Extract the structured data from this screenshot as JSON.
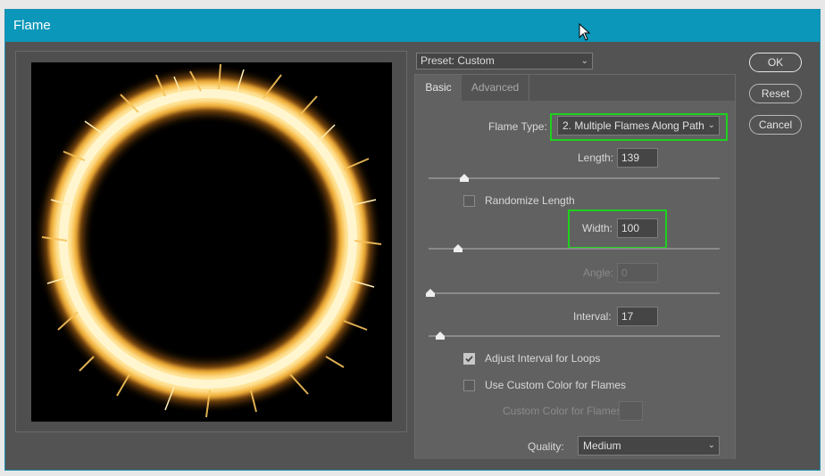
{
  "window": {
    "title": "Flame"
  },
  "preset": {
    "label": "Preset: Custom"
  },
  "tabs": [
    {
      "label": "Basic"
    },
    {
      "label": "Advanced"
    }
  ],
  "basic": {
    "flame_type": {
      "label": "Flame Type:",
      "value": "2. Multiple Flames Along Path"
    },
    "length": {
      "label": "Length:",
      "value": "139",
      "level": 0.12
    },
    "randomize_length": {
      "label": "Randomize Length",
      "checked": false
    },
    "width": {
      "label": "Width:",
      "value": "100",
      "level": 0.1
    },
    "angle": {
      "label": "Angle:",
      "value": "0",
      "disabled": true,
      "level": 0.0
    },
    "interval": {
      "label": "Interval:",
      "value": "17",
      "level": 0.04
    },
    "adjust_interval": {
      "label": "Adjust Interval for Loops",
      "checked": true
    },
    "custom_color": {
      "label": "Use Custom Color for Flames",
      "checked": false
    },
    "custom_color_swatch": {
      "label": "Custom Color for Flames:",
      "disabled": true
    },
    "quality": {
      "label": "Quality:",
      "value": "Medium"
    }
  },
  "buttons": {
    "ok": "OK",
    "reset": "Reset",
    "cancel": "Cancel"
  },
  "colors": {
    "titlebar": "#0b97b9",
    "highlight": "#1dd11d",
    "flame_core": "#fff6cf",
    "flame_edge": "#f3b33a"
  }
}
